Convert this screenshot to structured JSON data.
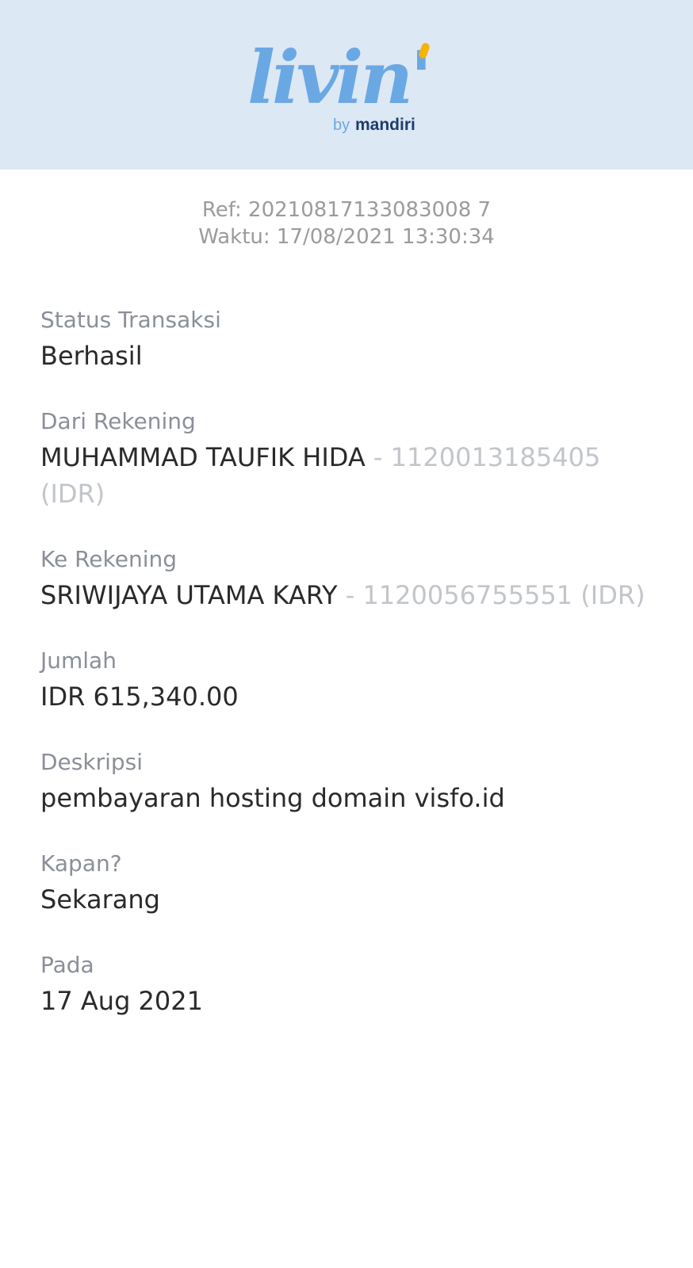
{
  "header": {
    "logo_text": "livin'",
    "logo_sub_by": "by",
    "logo_sub_brand": "mandiri"
  },
  "receipt": {
    "ref": "Ref: 20210817133083008 7",
    "time": "Waktu: 17/08/2021 13:30:34"
  },
  "fields": {
    "status": {
      "label": "Status Transaksi",
      "value": "Berhasil"
    },
    "from": {
      "label": "Dari Rekening",
      "name": "MUHAMMAD TAUFIK HIDA",
      "account": " - 1120013185405 (IDR)"
    },
    "to": {
      "label": "Ke Rekening",
      "name": "SRIWIJAYA UTAMA KARY",
      "account": " - 1120056755551 (IDR)"
    },
    "amount": {
      "label": "Jumlah",
      "value": "IDR 615,340.00"
    },
    "description": {
      "label": "Deskripsi",
      "value": "pembayaran hosting domain visfo.id"
    },
    "when": {
      "label": "Kapan?",
      "value": "Sekarang"
    },
    "on": {
      "label": "Pada",
      "value": "17 Aug 2021"
    }
  },
  "colors": {
    "header_bg": "#dce8f4",
    "logo_blue": "#6aa8e4",
    "logo_yellow": "#f5b400",
    "brand_navy": "#1d3c6e",
    "label_gray": "#8a8f98",
    "value_dark": "#2a2a2a",
    "muted_gray": "#c2c5ca"
  }
}
